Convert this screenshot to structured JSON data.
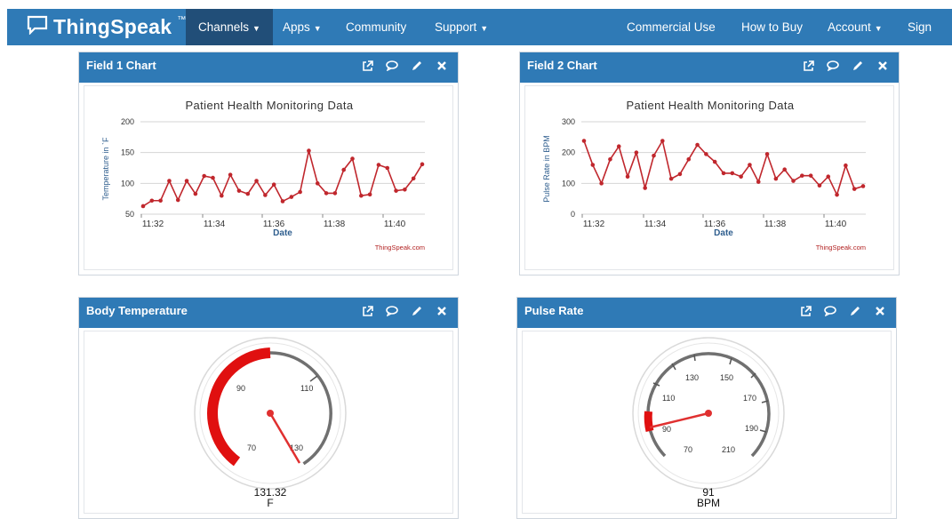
{
  "brand": {
    "name": "ThingSpeak",
    "tm": "™"
  },
  "nav": {
    "channels": "Channels",
    "apps": "Apps",
    "community": "Community",
    "support": "Support",
    "commercial": "Commercial Use",
    "how_to_buy": "How to Buy",
    "account": "Account",
    "sign_out": "Sign Out"
  },
  "panels": {
    "field1": {
      "title": "Field 1 Chart"
    },
    "field2": {
      "title": "Field 2 Chart"
    },
    "body_temp": {
      "title": "Body Temperature"
    },
    "pulse": {
      "title": "Pulse Rate"
    }
  },
  "colors": {
    "nav": "#2f7ab6",
    "nav_active": "#214e78",
    "series": "#c0272d",
    "gauge_red": "#e01010"
  },
  "chart_data": [
    {
      "type": "line",
      "title": "Patient Health Monitoring Data",
      "xlabel": "Date",
      "ylabel": "Temperature in `F",
      "credit": "ThingSpeak.com",
      "x_ticks": [
        "11:32",
        "11:34",
        "11:36",
        "11:38",
        "11:40"
      ],
      "y_ticks": [
        50,
        100,
        150,
        200
      ],
      "ylim": [
        50,
        200
      ],
      "xlim": [
        0,
        28
      ],
      "grid": true,
      "series": [
        {
          "values": [
            63,
            72,
            72,
            104,
            73,
            104,
            83,
            112,
            109,
            80,
            114,
            88,
            83,
            104,
            81,
            98,
            71,
            78,
            86,
            153,
            100,
            84,
            84,
            122,
            140,
            80,
            82,
            130,
            125,
            88,
            90,
            108,
            131
          ]
        }
      ]
    },
    {
      "type": "line",
      "title": "Patient Health Monitoring Data",
      "xlabel": "Date",
      "ylabel": "Pulse Rate in BPM",
      "credit": "ThingSpeak.com",
      "x_ticks": [
        "11:32",
        "11:34",
        "11:36",
        "11:38",
        "11:40"
      ],
      "y_ticks": [
        0,
        100,
        200,
        300
      ],
      "ylim": [
        0,
        300
      ],
      "grid": true,
      "series": [
        {
          "values": [
            238,
            160,
            100,
            178,
            220,
            122,
            200,
            85,
            190,
            238,
            115,
            130,
            178,
            225,
            195,
            170,
            133,
            133,
            122,
            160,
            105,
            195,
            115,
            145,
            108,
            125,
            125,
            93,
            122,
            63,
            158,
            82,
            91
          ]
        }
      ]
    }
  ],
  "gauges": {
    "temp": {
      "value": "131.32",
      "unit": "F",
      "labels": [
        "70",
        "90",
        "110",
        "130"
      ]
    },
    "pulse": {
      "value": "91",
      "unit": "BPM",
      "labels": [
        "70",
        "90",
        "110",
        "130",
        "150",
        "170",
        "190",
        "210"
      ]
    }
  }
}
